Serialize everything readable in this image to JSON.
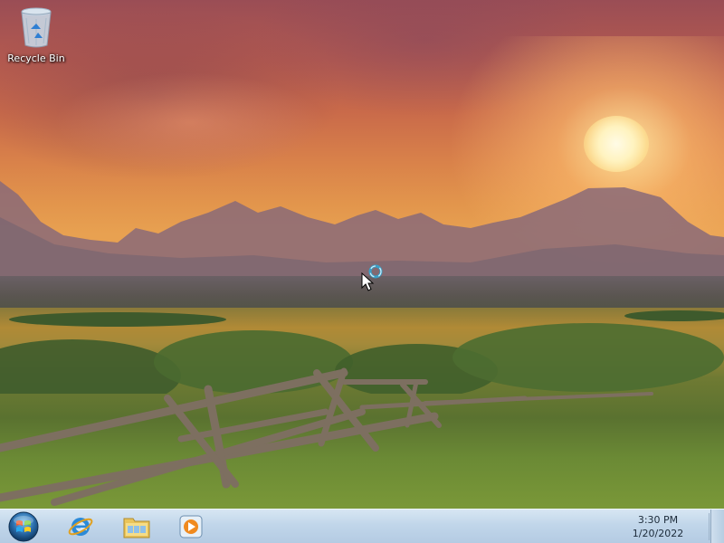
{
  "desktop": {
    "icons": [
      {
        "label": "Recycle Bin",
        "icon": "recycle-bin-icon"
      }
    ]
  },
  "taskbar": {
    "start_icon": "windows-start-orb-icon",
    "pinned": [
      {
        "icon": "internet-explorer-icon"
      },
      {
        "icon": "file-explorer-icon"
      },
      {
        "icon": "media-player-icon"
      }
    ],
    "clock": {
      "time": "3:30 PM",
      "date": "1/20/2022"
    }
  },
  "colors": {
    "taskbar_top": "#d7e6f3",
    "taskbar_bottom": "#b4cbe3",
    "sky_sunset": "#e2954c"
  }
}
